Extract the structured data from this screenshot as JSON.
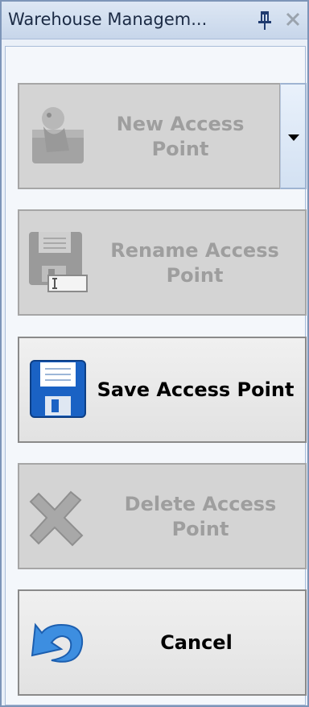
{
  "window": {
    "title": "Warehouse Managem...",
    "icons": [
      "pin-icon",
      "close-icon"
    ]
  },
  "buttons": {
    "new_access_point": {
      "label_line1": "New Access",
      "label_line2": "Point",
      "icon": "new-access-point-icon",
      "enabled": false
    },
    "new_access_point_dropdown": {
      "icon": "dropdown-arrow-icon"
    },
    "rename_access_point": {
      "label_line1": "Rename Access",
      "label_line2": "Point",
      "icon": "rename-floppy-icon",
      "enabled": false
    },
    "save_access_point": {
      "label": "Save Access Point",
      "icon": "floppy-disk-icon",
      "enabled": true
    },
    "delete_access_point": {
      "label_line1": "Delete Access",
      "label_line2": "Point",
      "icon": "delete-x-icon",
      "enabled": false
    },
    "cancel": {
      "label": "Cancel",
      "icon": "undo-arrow-icon",
      "enabled": true
    }
  },
  "colors": {
    "disabled_text": "#9e9e9e",
    "enabled_text": "#000000",
    "floppy_blue": "#1a62c4",
    "undo_blue": "#3d8ee0"
  }
}
